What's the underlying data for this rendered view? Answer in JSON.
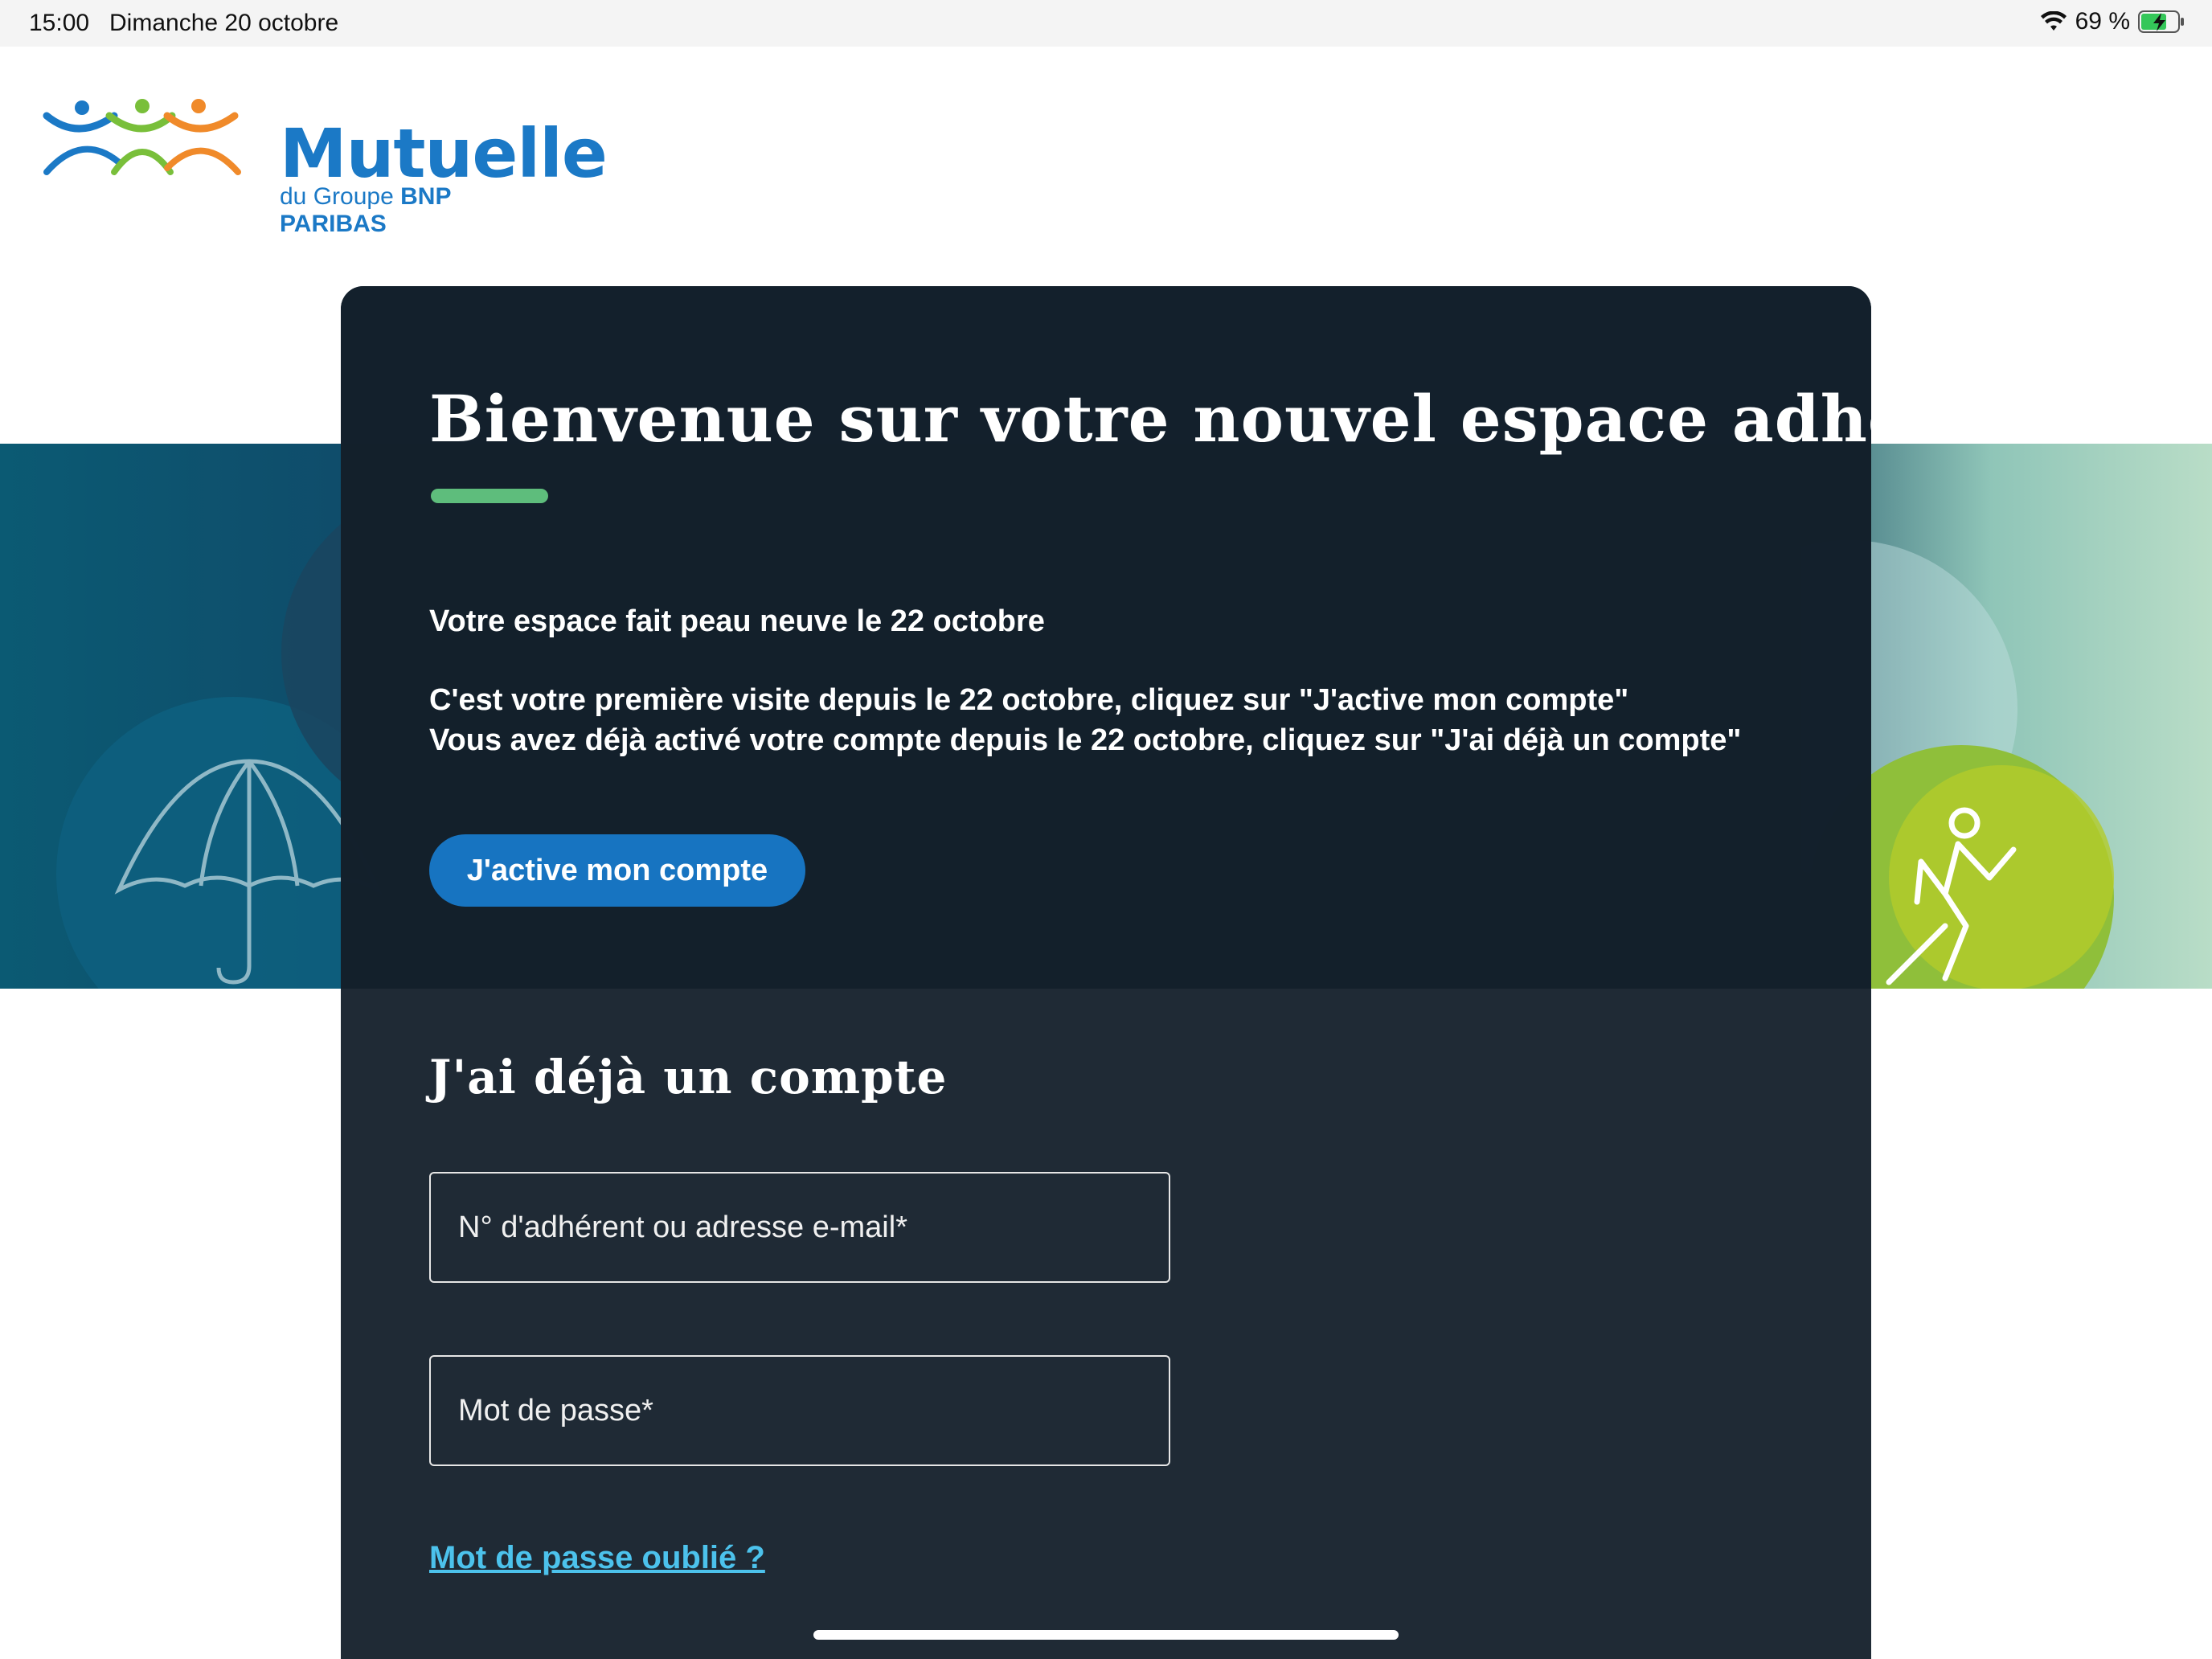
{
  "status_bar": {
    "time": "15:00",
    "date": "Dimanche 20 octobre",
    "battery": "69 %",
    "icons": [
      "wifi-icon",
      "battery-charging-icon"
    ]
  },
  "brand": {
    "title": "Mutuelle",
    "subtitle_prefix": "du Groupe ",
    "subtitle_bold": "BNP PARIBAS",
    "colors": {
      "blue": "#1b79c6",
      "green": "#79bf3a",
      "orange": "#f08a2a"
    }
  },
  "card": {
    "title": "Bienvenue sur votre nouvel espace adhérent",
    "intro": "Votre espace fait peau neuve le 22 octobre",
    "line1": "C'est votre première visite depuis le 22 octobre, cliquez sur \"J'active mon compte\"",
    "line2": "Vous avez déjà activé votre compte depuis le 22 octobre, cliquez sur \"J'ai déjà un compte\"",
    "activate_button": "J'active mon compte",
    "accent_color": "#5ebd7c",
    "button_color": "#1774c1"
  },
  "login": {
    "title": "J'ai déjà un compte",
    "id_placeholder": "N° d'adhérent ou adresse e-mail*",
    "password_placeholder": "Mot de passe*",
    "forgot_link": "Mot de passe oublié ?",
    "link_color": "#4cc2ec"
  },
  "hero_icons": [
    "umbrella-icon",
    "heart-icon",
    "eye-icon",
    "runner-icon"
  ]
}
